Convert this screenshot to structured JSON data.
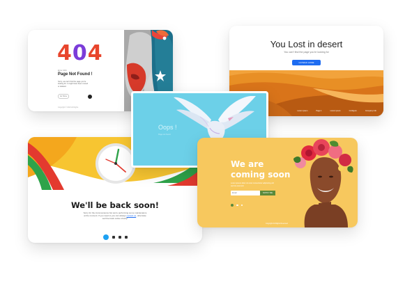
{
  "card_404": {
    "digit_1": "4",
    "digit_2": "0",
    "digit_3": "4",
    "overline": "Error 404",
    "title": "Page Not Found !",
    "description": "Sorry, we can't find the page you're looking for. It might have been moved or deleted.",
    "go_home_label": "Go Home",
    "copyright": "Copyright © 2023 All Rights",
    "accent_colors": [
      "#e8452c",
      "#7b3cd9"
    ]
  },
  "card_desert": {
    "title": "You Lost in desert",
    "subtitle": "You can't find the page you're looking for",
    "button_label": "GO BACK HOME",
    "footer_links": [
      "Lorem ipsum",
      "Page 1",
      "Lorem ipsum",
      "Configure",
      "Company Info"
    ],
    "accent_color": "#1e6cf1"
  },
  "card_oops": {
    "title": "Oops !",
    "line": "Page not found",
    "background_color": "#6cd0e8"
  },
  "card_back_soon": {
    "title": "We'll be back soon!",
    "description": "Sorry for the inconvenience but we're performing some maintenance at the moment. If you need to you can always",
    "contact_link": "contact us",
    "description_tail": ", otherwise we'll be back online shortly!",
    "social_icons": [
      "twitter-icon",
      "square-icon",
      "square-icon",
      "square-icon"
    ]
  },
  "card_coming_soon": {
    "title_line_1": "We are",
    "title_line_2": "coming soon",
    "subtitle": "Lorem ipsum dolor sit amet consectetur adipiscing elit sed do eiusmod.",
    "email_placeholder": "Email",
    "notify_label": "NOTIFY ME",
    "footer": "Copyright All Rights Reserved",
    "background_color": "#f7c85e",
    "accent_color": "#5b8a3b"
  }
}
